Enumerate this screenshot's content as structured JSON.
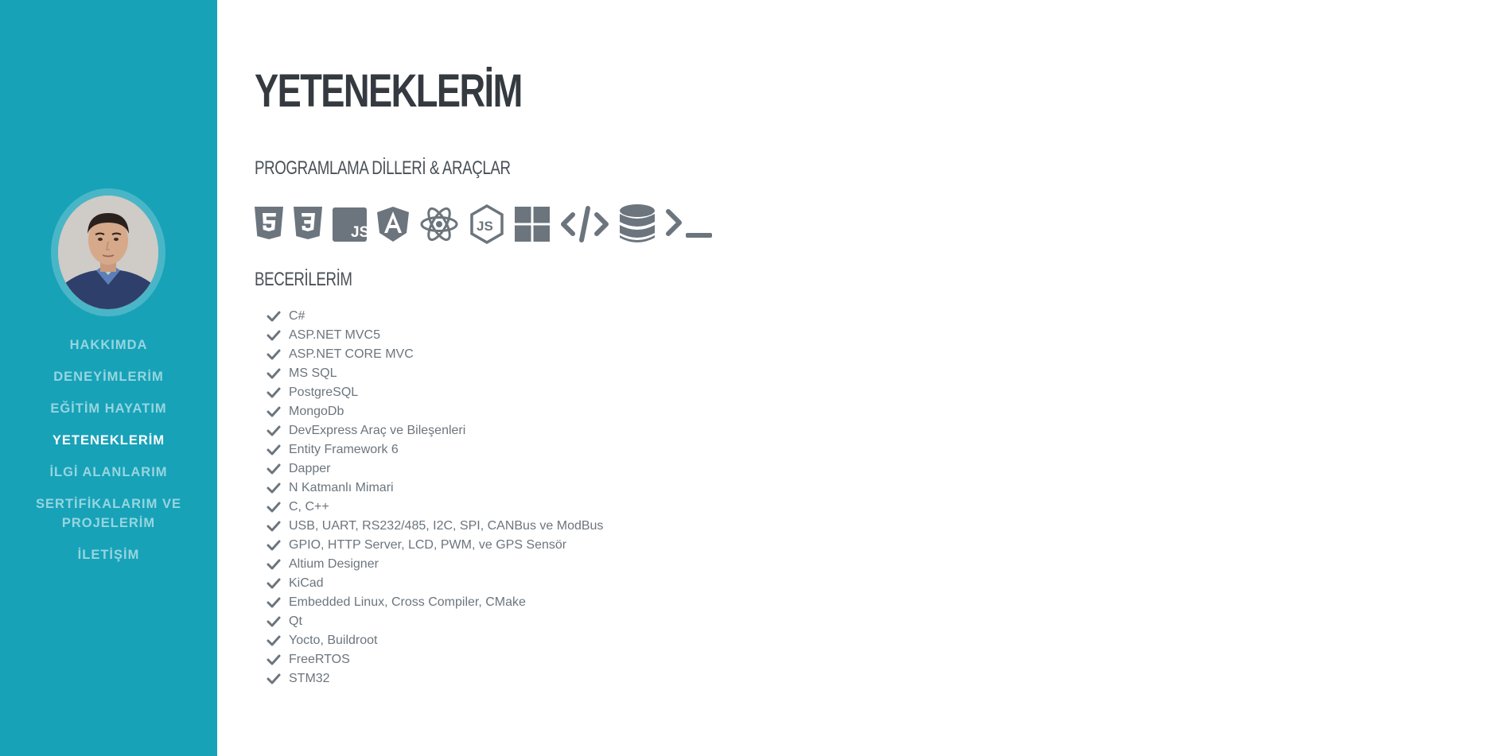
{
  "sidebar": {
    "avatar": "profile-photo",
    "nav": [
      {
        "label": "HAKKIMDA",
        "active": false
      },
      {
        "label": "DENEYİMLERİM",
        "active": false
      },
      {
        "label": "EĞİTİM HAYATIM",
        "active": false
      },
      {
        "label": "YETENEKLERİM",
        "active": true
      },
      {
        "label": "İLGİ ALANLARIM",
        "active": false
      },
      {
        "label": "SERTİFİKALARIM VE PROJELERİM",
        "active": false
      },
      {
        "label": "İLETİŞİM",
        "active": false
      }
    ],
    "colors": {
      "background": "#17a2b8",
      "active_text": "#ffffff"
    }
  },
  "main": {
    "title": "YETENEKLERİM",
    "tools_heading": "PROGRAMLAMA DİLLERİ & ARAÇLAR",
    "tool_icons": [
      "html5-icon",
      "css3-icon",
      "javascript-icon",
      "angular-icon",
      "react-icon",
      "nodejs-icon",
      "windows-icon",
      "code-icon",
      "database-icon",
      "terminal-icon"
    ],
    "skills_heading": "BECERİLERİM",
    "skills": [
      "C#",
      "ASP.NET MVC5",
      "ASP.NET CORE MVC",
      "MS SQL",
      "PostgreSQL",
      "MongoDb",
      "DevExpress Araç ve Bileşenleri",
      "Entity Framework 6",
      "Dapper",
      "N Katmanlı Mimari",
      "C, C++",
      "USB, UART, RS232/485, I2C, SPI, CANBus ve ModBus",
      "GPIO, HTTP Server, LCD, PWM, ve GPS Sensör",
      "Altium Designer",
      "KiCad",
      "Embedded Linux, Cross Compiler, CMake",
      "Qt",
      "Yocto, Buildroot",
      "FreeRTOS",
      "STM32"
    ],
    "colors": {
      "icon": "#6c757d",
      "title": "#343a40"
    }
  }
}
